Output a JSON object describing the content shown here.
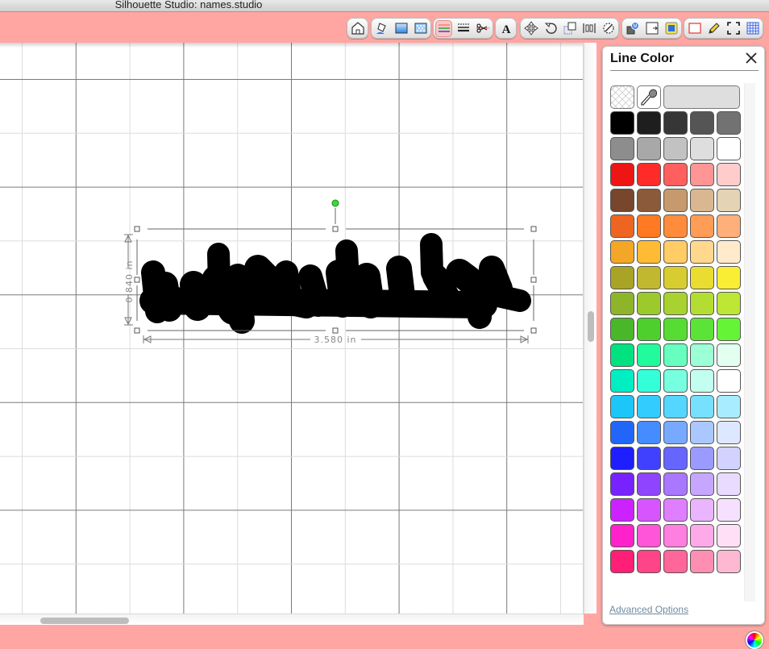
{
  "window": {
    "title": "Silhouette Studio: names.studio"
  },
  "toolbar": {
    "groups": [
      {
        "name": "page",
        "buttons": [
          {
            "icon": "house-icon",
            "label": "Page Setup"
          }
        ]
      },
      {
        "name": "fill",
        "buttons": [
          {
            "icon": "fill-bucket-icon",
            "label": "Fill Color"
          },
          {
            "icon": "gradient-icon",
            "label": "Fill Gradient"
          },
          {
            "icon": "pattern-icon",
            "label": "Fill Pattern"
          }
        ]
      },
      {
        "name": "line",
        "buttons": [
          {
            "icon": "line-color-icon",
            "label": "Line Color",
            "active": true
          },
          {
            "icon": "line-style-icon",
            "label": "Line Style"
          },
          {
            "icon": "cut-settings-icon",
            "label": "Cut Settings"
          }
        ]
      },
      {
        "name": "text",
        "buttons": [
          {
            "icon": "text-style-icon",
            "label": "Text Style",
            "glyph": "A"
          }
        ]
      },
      {
        "name": "transform",
        "buttons": [
          {
            "icon": "move-icon",
            "label": "Move"
          },
          {
            "icon": "rotate-icon",
            "label": "Rotate"
          },
          {
            "icon": "scale-icon",
            "label": "Scale"
          },
          {
            "icon": "align-icon",
            "label": "Align"
          },
          {
            "icon": "replicate-icon",
            "label": "Replicate"
          }
        ]
      },
      {
        "name": "modify",
        "buttons": [
          {
            "icon": "modify-icon",
            "label": "Modify"
          },
          {
            "icon": "offset-icon",
            "label": "Offset"
          },
          {
            "icon": "trace-icon",
            "label": "Trace"
          }
        ]
      },
      {
        "name": "view",
        "buttons": [
          {
            "icon": "registration-marks-icon",
            "label": "Registration Marks"
          },
          {
            "icon": "sketch-pencil-icon",
            "label": "Sketch"
          },
          {
            "icon": "fullscreen-icon",
            "label": "Full Screen"
          },
          {
            "icon": "grid-icon",
            "label": "Grid"
          }
        ]
      }
    ]
  },
  "canvas": {
    "selection": {
      "width_label": "3.580 in",
      "height_label": "0.840 in",
      "fill_color": "#000000",
      "rotate_handle_color": "#33dd33"
    }
  },
  "panel": {
    "title": "Line Color",
    "close_icon": "close-icon",
    "top_row": [
      {
        "name": "no-color-swatch",
        "icon": "crosshatch"
      },
      {
        "name": "eyedropper-button",
        "icon": "eyedropper-icon"
      },
      {
        "name": "current-color-swatch",
        "color": "#dedede"
      }
    ],
    "swatch_rows": [
      [
        "#000000",
        "#1e1e1e",
        "#363636",
        "#555555",
        "#727272"
      ],
      [
        "#8d8d8d",
        "#a8a8a8",
        "#c2c2c2",
        "#dedede",
        "#ffffff"
      ],
      [
        "#ee1515",
        "#ff2b2b",
        "#ff5f5f",
        "#ff9595",
        "#ffcccc"
      ],
      [
        "#77462c",
        "#8b5a3a",
        "#c69a6d",
        "#d9b891",
        "#e5d3b5"
      ],
      [
        "#ee6522",
        "#ff7a22",
        "#ff8c3a",
        "#ff9d57",
        "#ffb07a"
      ],
      [
        "#f4a626",
        "#ffbb33",
        "#ffcc66",
        "#ffd88e",
        "#ffeacc"
      ],
      [
        "#a9a426",
        "#c1b830",
        "#d7cd30",
        "#e9dd32",
        "#f9ee33"
      ],
      [
        "#8eb52a",
        "#9cc92c",
        "#a7d22f",
        "#b4dd33",
        "#bde635"
      ],
      [
        "#4ab72a",
        "#4ecf2d",
        "#57dc33",
        "#5be437",
        "#66f436"
      ],
      [
        "#00e280",
        "#22fb9c",
        "#66ffc0",
        "#9dffd6",
        "#e2fff0"
      ],
      [
        "#00efc2",
        "#33ffd8",
        "#77ffe0",
        "#c2fff0",
        "#ffffff"
      ],
      [
        "#1dc6f8",
        "#33ccff",
        "#55d6ff",
        "#77e0ff",
        "#a8ecff"
      ],
      [
        "#2166f8",
        "#448cff",
        "#77aaff",
        "#aac8ff",
        "#dde7ff"
      ],
      [
        "#1e1eff",
        "#4040ff",
        "#6666ff",
        "#9b9bff",
        "#d2d2ff"
      ],
      [
        "#7722ff",
        "#8f44ff",
        "#aa77ff",
        "#c7a6ff",
        "#e8dbff"
      ],
      [
        "#cc22ff",
        "#d755ff",
        "#df7fff",
        "#ebb4ff",
        "#f6e0ff"
      ],
      [
        "#ff22cc",
        "#ff55d8",
        "#ff7fe0",
        "#ffaae8",
        "#ffdff5"
      ],
      [
        "#ff1f77",
        "#ff4488",
        "#ff6699",
        "#ff8fb2",
        "#ffb8d2"
      ]
    ],
    "advanced_label": "Advanced Options"
  }
}
